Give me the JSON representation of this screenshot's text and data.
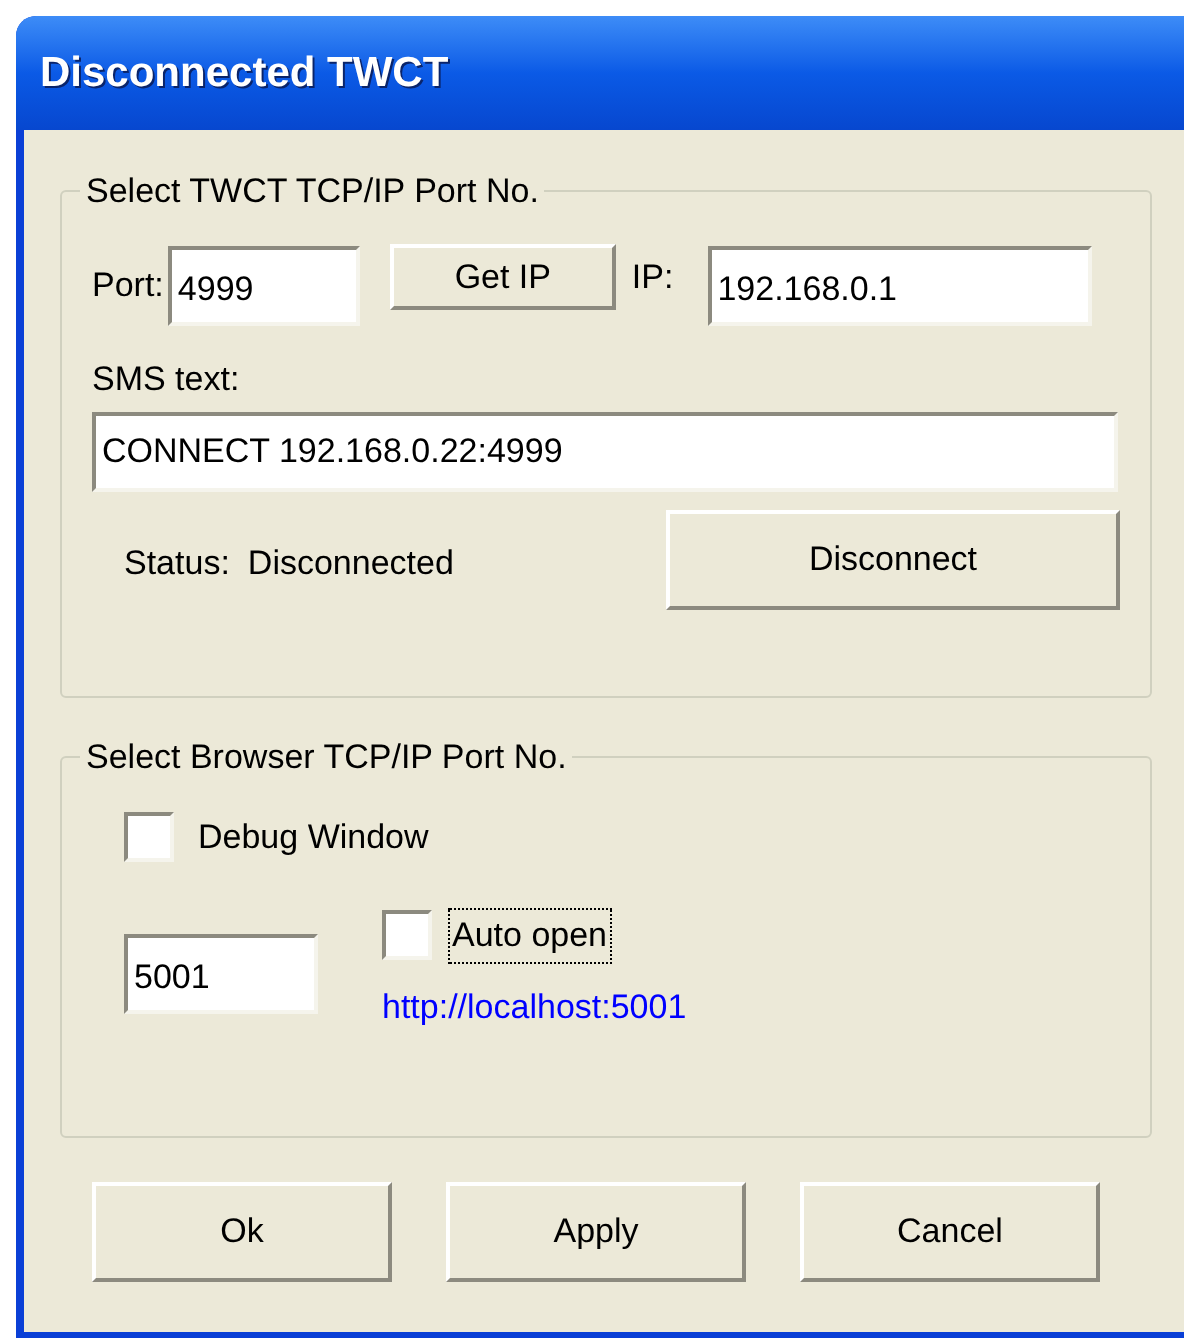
{
  "window": {
    "title": "Disconnected TWCT"
  },
  "twct_group": {
    "legend": "Select TWCT TCP/IP Port No.",
    "port_label": "Port:",
    "port": "4999",
    "get_ip_button": "Get IP",
    "ip_label": "IP:",
    "ip": "192.168.0.1",
    "sms_label": "SMS text:",
    "sms": "CONNECT 192.168.0.22:4999",
    "status_label": "Status:",
    "status": "Disconnected",
    "disconnect_button": "Disconnect"
  },
  "browser_group": {
    "legend": "Select Browser TCP/IP Port No.",
    "debug_window": {
      "label": "Debug Window",
      "checked": false
    },
    "port": "5001",
    "auto_open": {
      "label": "Auto open",
      "checked": false,
      "focused": true
    },
    "link": "http://localhost:5001"
  },
  "buttons": [
    "Ok",
    "Apply",
    "Cancel"
  ]
}
